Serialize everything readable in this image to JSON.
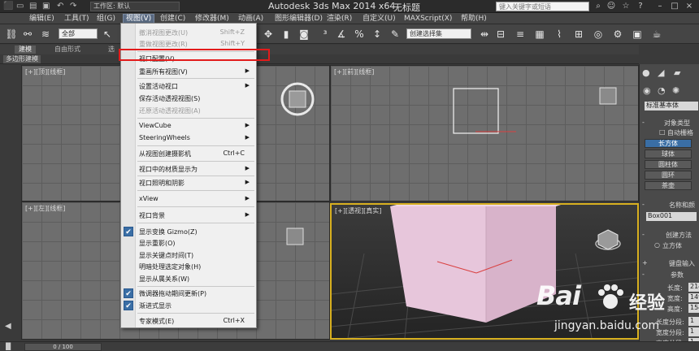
{
  "titlebar": {
    "workspace": "工作区: 默认",
    "app_title": "Autodesk 3ds Max  2014 x64",
    "doc_title": "无标题",
    "search_placeholder": "键入关键字或短语"
  },
  "menubar": {
    "items": [
      {
        "label": "编辑(E)"
      },
      {
        "label": "工具(T)"
      },
      {
        "label": "组(G)"
      },
      {
        "label": "视图(V)"
      },
      {
        "label": "创建(C)"
      },
      {
        "label": "修改器(M)"
      },
      {
        "label": "动画(A)"
      },
      {
        "label": "图形编辑器(D)"
      },
      {
        "label": "渲染(R)"
      },
      {
        "label": "自定义(U)"
      },
      {
        "label": "MAXScript(X)"
      },
      {
        "label": "帮助(H)"
      }
    ]
  },
  "toolbar": {
    "selection_filter": "全部",
    "named_selection": "创建选择集"
  },
  "ribbon": {
    "tabs": [
      {
        "label": "建模"
      },
      {
        "label": "自由形式"
      },
      {
        "label": "选"
      }
    ],
    "subtab": "多边形建模"
  },
  "viewports": {
    "top_left": "[+][顶][线框]",
    "top_right": "[+][前][线框]",
    "bottom_left": "[+][左][线框]",
    "bottom_right": "[+][透视][真实]"
  },
  "view_menu": {
    "items": [
      {
        "label": "撤消视图更改(U)",
        "shortcut": "Shift+Z",
        "disabled": true
      },
      {
        "label": "重做视图更改(R)",
        "shortcut": "Shift+Y",
        "disabled": true
      },
      {
        "label": "视口配置(V)...",
        "highlighted": true
      },
      {
        "label": "重画所有视图(V)"
      },
      {
        "label": "设置活动视口"
      },
      {
        "label": "保存活动透视视图(S)"
      },
      {
        "label": "还原活动透视视图(A)",
        "disabled": true
      },
      {
        "label": "ViewCube"
      },
      {
        "label": "SteeringWheels"
      },
      {
        "label": "从视图创建摄影机",
        "shortcut": "Ctrl+C"
      },
      {
        "label": "视口中的材质显示为"
      },
      {
        "label": "视口照明和阴影"
      },
      {
        "label": "xView"
      },
      {
        "label": "视口背景"
      },
      {
        "label": "显示变换 Gizmo(Z)",
        "checked": true
      },
      {
        "label": "显示重影(O)"
      },
      {
        "label": "显示关键点时间(T)"
      },
      {
        "label": "明暗处理选定对象(H)"
      },
      {
        "label": "显示从属关系(W)"
      },
      {
        "label": "微调器拖动期间更新(P)",
        "checked": true
      },
      {
        "label": "渐进式显示",
        "checked": true
      },
      {
        "label": "专家模式(E)",
        "shortcut": "Ctrl+X"
      }
    ]
  },
  "command_panel": {
    "dropdown": "标准基本体",
    "rollout_object_type": "对象类型",
    "auto_grid": "自动栅格",
    "buttons": [
      "长方体",
      "球体",
      "圆柱体",
      "圆环",
      "茶壶"
    ],
    "rollout_name_color": "名称和颜",
    "object_name": "Box001",
    "rollout_creation_method": "创建方法",
    "creation_option": "立方体",
    "rollout_keyboard_entry": "键盘输入",
    "rollout_parameters": "参数",
    "params": [
      {
        "label": "长度:",
        "value": "214"
      },
      {
        "label": "宽度:",
        "value": "149"
      },
      {
        "label": "高度:",
        "value": "154"
      },
      {
        "label": "长度分段:",
        "value": "1"
      },
      {
        "label": "宽度分段:",
        "value": "1"
      },
      {
        "label": "高度分段:",
        "value": "1"
      }
    ]
  },
  "statusbar": {
    "time_slider": "0 / 100"
  },
  "watermark": {
    "logo": "Bai",
    "brand_sub": "经验",
    "url": "jingyan.baidu.com"
  },
  "colors": {
    "menu_highlight": "#e21b1b",
    "active_viewport": "#d8b020",
    "box_fill": "#e9c9dd",
    "selected_button": "#3a6ea5"
  }
}
